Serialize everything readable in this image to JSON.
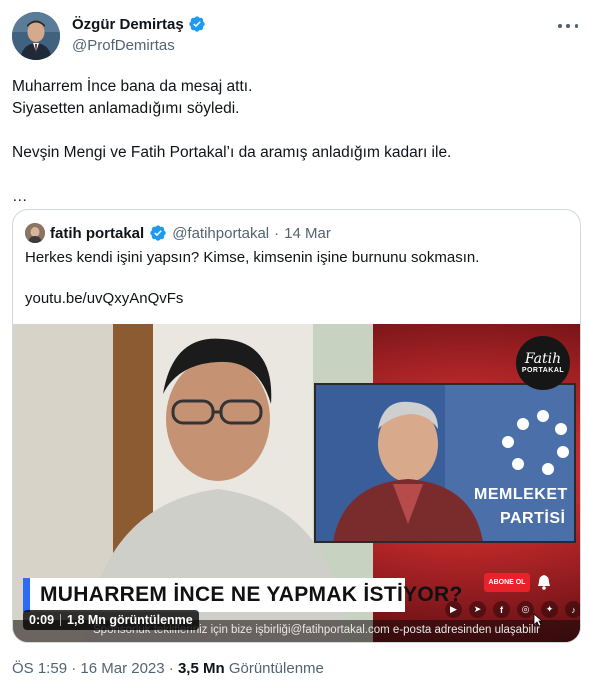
{
  "author": {
    "name": "Özgür Demirtaş",
    "handle": "@ProfDemirtas",
    "verified": true,
    "verified_color": "#1d9bf0"
  },
  "tweet": {
    "paragraphs": [
      "Muharrem İnce bana da mesaj attı.\nSiyasetten anlamadığımı söyledi.",
      "Nevşin Mengi ve Fatih Portakal’ı da aramış anladığım kadarı ile.",
      "…"
    ]
  },
  "quoted": {
    "name": "fatih portakal",
    "handle": "@fatihportakal",
    "separator": "·",
    "date": "14 Mar",
    "text": "Herkes kendi işini yapsın? Kimse, kimsenin işine burnunu sokmasın.",
    "link": "youtu.be/uvQxyAnQvFs",
    "video": {
      "banner": "MUHARREM İNCE NE YAPMAK İSTİYOR?",
      "elapsed": "0:09",
      "views": "1,8 Mn görüntülenme",
      "ticker": "Sponsorluk teklifleriniz için bize işbirliği@fatihportakal.com e-posta adresinden ulaşabilir",
      "subscribe_label": "ABONE OL",
      "channel_logo_script": "Fatih",
      "channel_logo_text": "PORTAKAL",
      "party_line1": "MEMLEKET",
      "party_line2": "PARTİSİ",
      "social_icons": [
        "youtube-icon",
        "telegram-icon",
        "facebook-icon",
        "instagram-icon",
        "twitter-icon",
        "tiktok-icon"
      ]
    }
  },
  "footer": {
    "time": "ÖS 1:59",
    "dot": "·",
    "date": "16 Mar 2023",
    "views_count": "3,5 Mn",
    "views_label": "Görüntülenme"
  }
}
